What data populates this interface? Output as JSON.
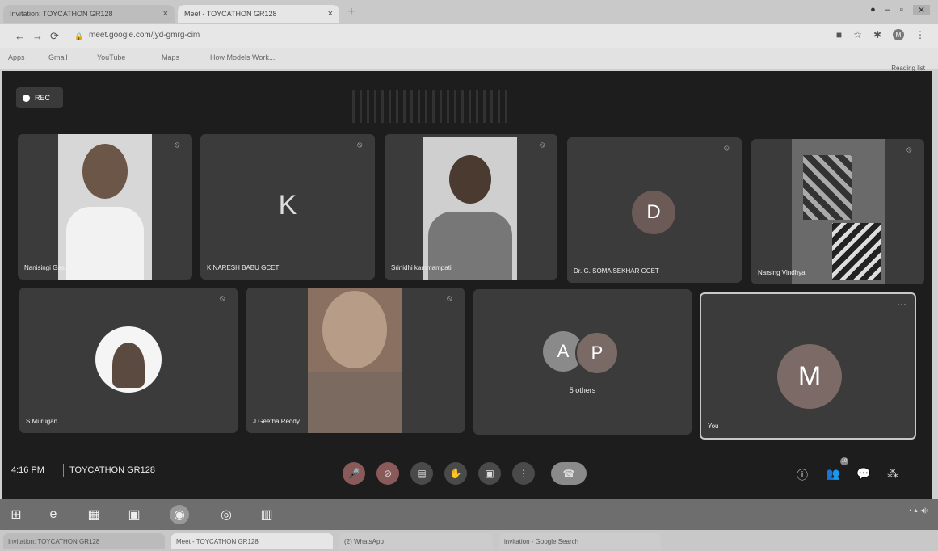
{
  "browser": {
    "tabs": [
      {
        "label": "Invitation: TOYCATHON GR128",
        "close": "×"
      },
      {
        "label": "Meet - TOYCATHON GR128",
        "close": "×"
      }
    ],
    "new_tab": "+",
    "url": "meet.google.com/jyd-gmrg-cim",
    "bookmarks": [
      "Apps",
      "Gmail",
      "YouTube",
      "Maps",
      "How Models Work..."
    ],
    "reading_list": "Reading list"
  },
  "meet": {
    "rec_label": "REC",
    "participants": [
      {
        "name": "Nanisingi Gasu...",
        "type": "photo"
      },
      {
        "name": "K NARESH BABU GCET",
        "type": "initial",
        "initial": "K"
      },
      {
        "name": "Srinidhi kammampati",
        "type": "photo"
      },
      {
        "name": "Dr. G. SOMA SEKHAR GCET",
        "type": "initial",
        "initial": "D"
      },
      {
        "name": "Narsing Vindhya",
        "type": "photo"
      },
      {
        "name": "S Murugan",
        "type": "photo"
      },
      {
        "name": "J.Geetha Reddy",
        "type": "photo"
      },
      {
        "name": "5 others",
        "type": "group",
        "initials": [
          "A",
          "P"
        ]
      },
      {
        "name": "You",
        "type": "initial",
        "initial": "M"
      }
    ],
    "time": "4:16 PM",
    "meeting_name": "TOYCATHON GR128",
    "people_count": "10"
  },
  "taskbar": {
    "bottom_tabs": [
      "Invitation: TOYCATHON GR128",
      "Meet - TOYCATHON GR128",
      "(2) WhatsApp",
      "invitation - Google Search"
    ]
  },
  "colors": {
    "meet_bg": "#1d1d1d",
    "tile_bg": "#3b3b3b",
    "avatar_d": "#6b5a56",
    "avatar_m": "#7b6a66",
    "avatar_a": "#8a8a8a",
    "avatar_p": "#7a6a66"
  },
  "icons": [
    "back-icon",
    "forward-icon",
    "reload-icon",
    "lock-icon",
    "mic-off-icon",
    "video-off-icon",
    "captions-icon",
    "raise-hand-icon",
    "present-icon",
    "more-icon",
    "hangup-icon",
    "info-icon",
    "people-icon",
    "chat-icon",
    "activities-icon"
  ]
}
